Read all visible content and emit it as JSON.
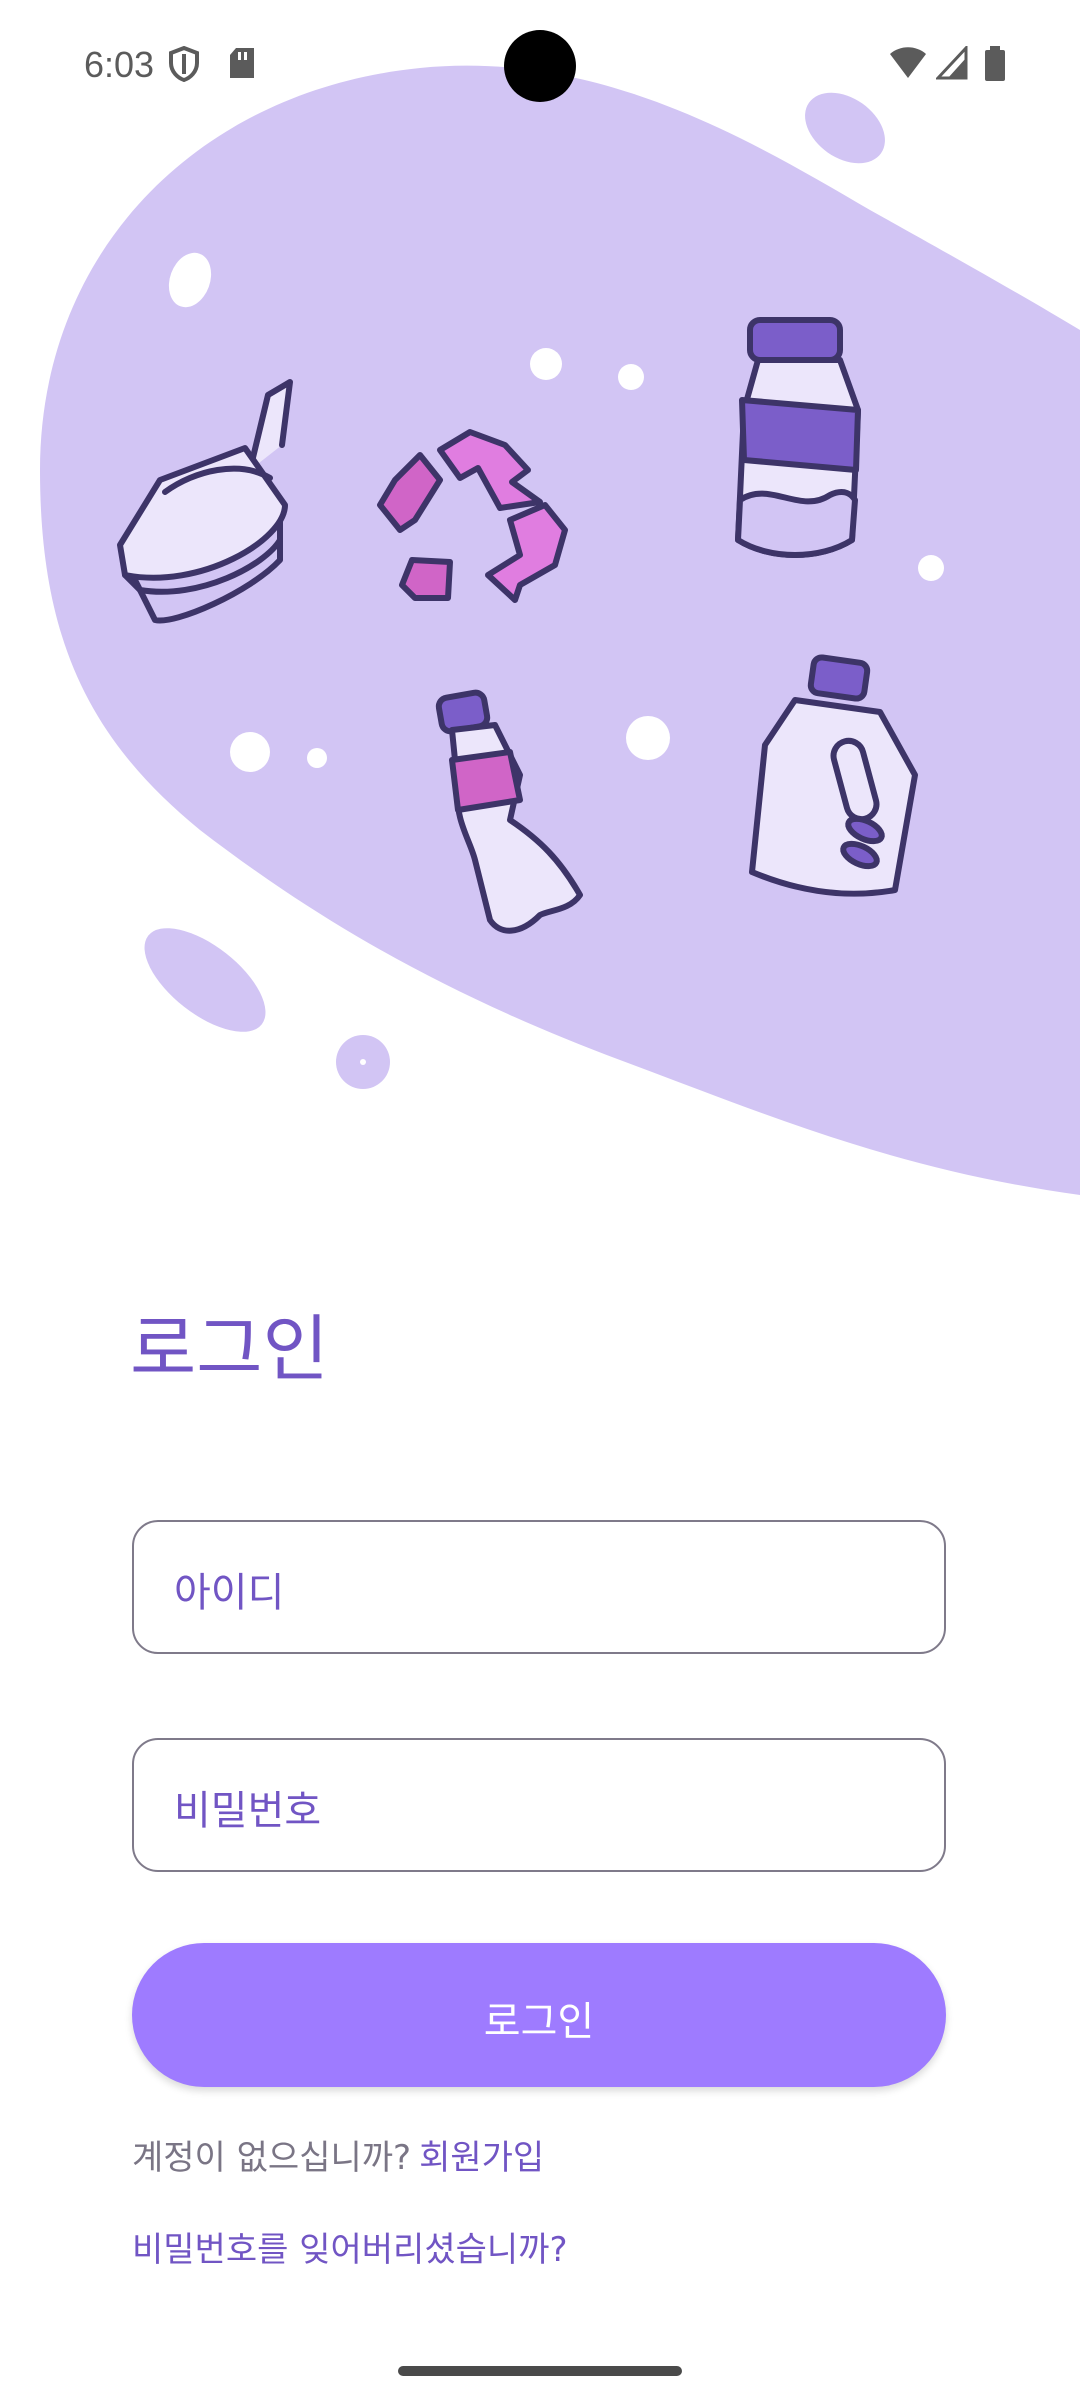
{
  "status_bar": {
    "time": "6:03",
    "icons": [
      "shield-icon",
      "sd-card-icon",
      "wifi-icon",
      "signal-icon",
      "battery-icon"
    ]
  },
  "hero": {
    "illustration": "recycling-plastics-illustration",
    "blob_color": "#d2c5f4",
    "accent_color": "#7155c4"
  },
  "login": {
    "title": "로그인",
    "id_placeholder": "아이디",
    "password_placeholder": "비밀번호",
    "submit_label": "로그인",
    "signup_prompt": "계정이 없으십니까?",
    "signup_link": "회원가입",
    "forgot_password_link": "비밀번호를 잊어버리셨습니까?"
  },
  "colors": {
    "primary": "#9e7bff",
    "text_accent": "#7155c4",
    "muted_text": "#7a7585"
  }
}
